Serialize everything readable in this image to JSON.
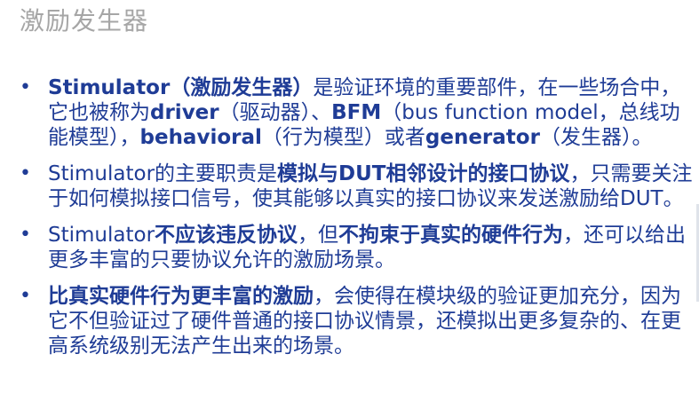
{
  "title": "激励发生器",
  "bullets": [
    {
      "segments": [
        {
          "text": "Stimulator（激励发生器）",
          "bold": true
        },
        {
          "text": "是验证环境的重要部件，在一些场合中，它也被称为",
          "bold": false
        },
        {
          "text": "driver",
          "bold": true
        },
        {
          "text": "（驱动器）、",
          "bold": false
        },
        {
          "text": "BFM",
          "bold": true
        },
        {
          "text": "（bus function model，总线功能模型），",
          "bold": false
        },
        {
          "text": "behavioral",
          "bold": true
        },
        {
          "text": "（行为模型）或者",
          "bold": false
        },
        {
          "text": "generator",
          "bold": true
        },
        {
          "text": "（发生器）。",
          "bold": false
        }
      ]
    },
    {
      "segments": [
        {
          "text": "Stimulator的主要职责是",
          "bold": false
        },
        {
          "text": "模拟与DUT相邻设计的接口协议",
          "bold": true
        },
        {
          "text": "，只需要关注于如何模拟接口信号，使其能够以真实的接口协议来发送激励给DUT。",
          "bold": false
        }
      ]
    },
    {
      "segments": [
        {
          "text": "Stimulator",
          "bold": false
        },
        {
          "text": "不应该违反协议",
          "bold": true
        },
        {
          "text": "，但",
          "bold": false
        },
        {
          "text": "不拘束于真实的硬件行为",
          "bold": true
        },
        {
          "text": "，还可以给出更多丰富的只要协议允许的激励场景。",
          "bold": false
        }
      ]
    },
    {
      "segments": [
        {
          "text": "比真实硬件行为更丰富的激励",
          "bold": true
        },
        {
          "text": "，会使得在模块级的验证更加充分，因为它不但验证过了硬件普通的接口协议情景，还模拟出更多复杂的、在更高系统级别无法产生出来的场景。",
          "bold": false
        }
      ]
    }
  ]
}
